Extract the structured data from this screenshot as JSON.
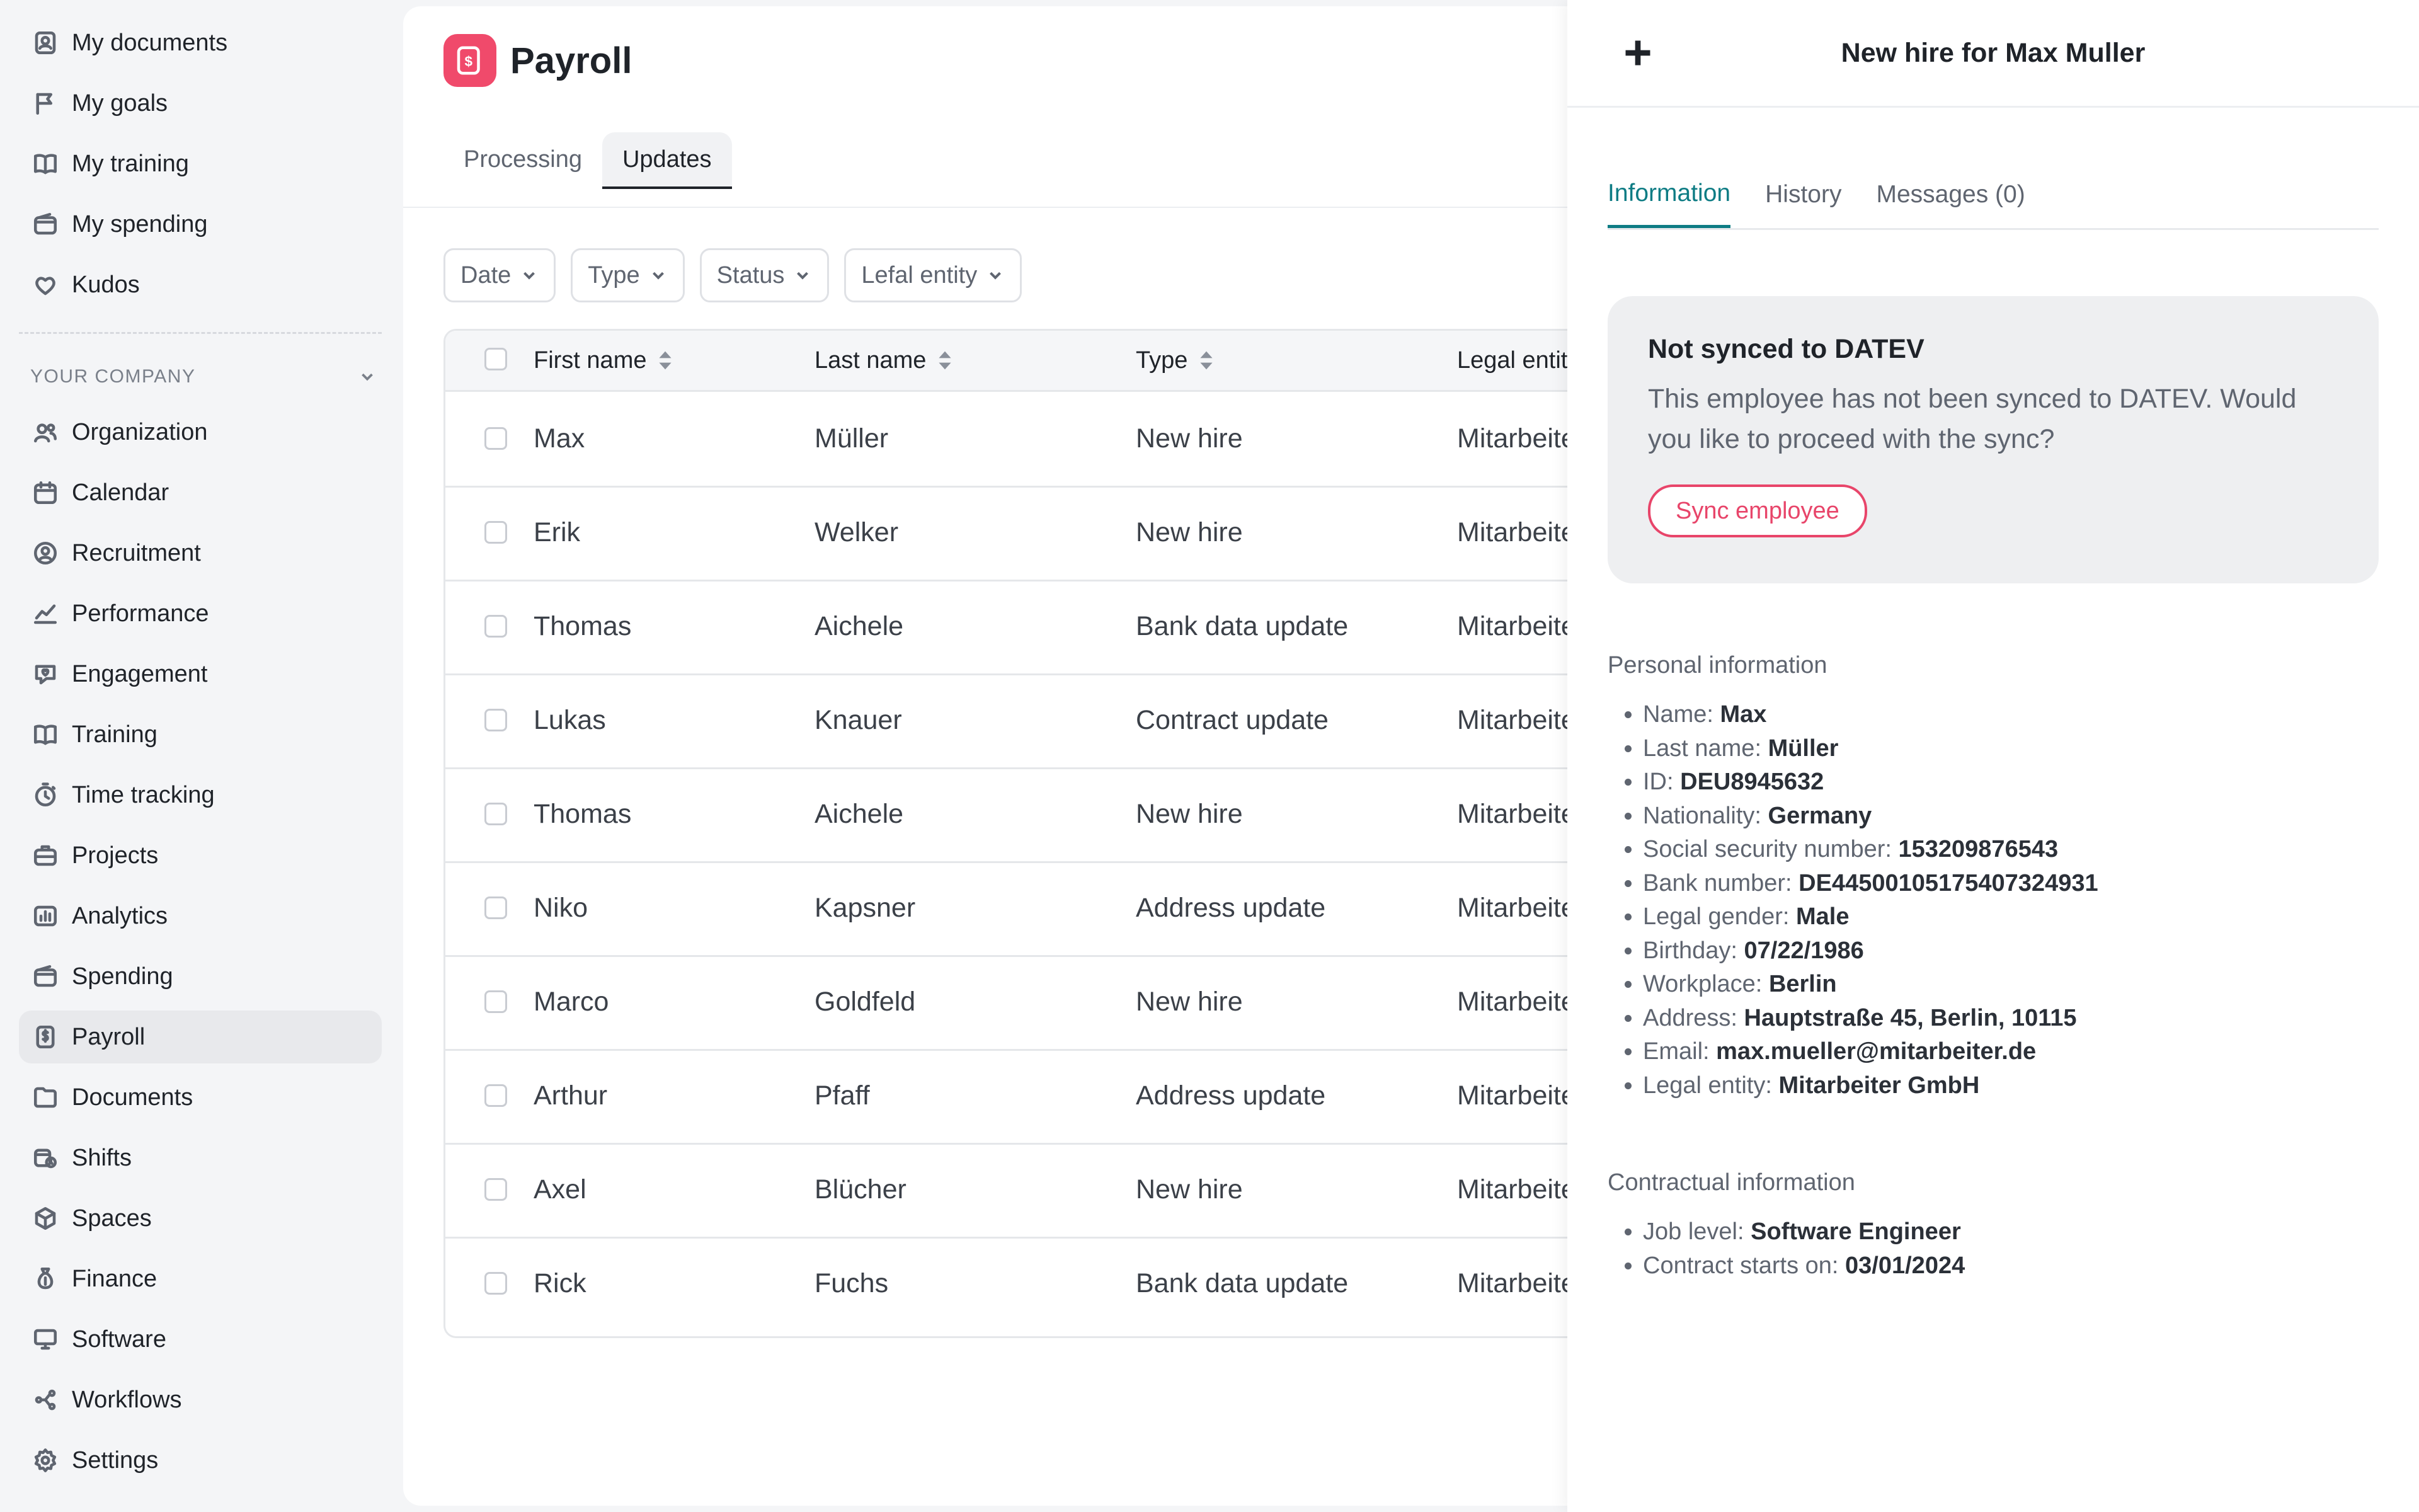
{
  "sidebar": {
    "personal": [
      {
        "label": "My documents",
        "icon": "user-badge-icon"
      },
      {
        "label": "My goals",
        "icon": "flag-icon"
      },
      {
        "label": "My training",
        "icon": "book-icon"
      },
      {
        "label": "My spending",
        "icon": "wallet-icon"
      },
      {
        "label": "Kudos",
        "icon": "heart-icon"
      }
    ],
    "section_label": "YOUR COMPANY",
    "company": [
      {
        "label": "Organization",
        "icon": "users-icon"
      },
      {
        "label": "Calendar",
        "icon": "calendar-icon"
      },
      {
        "label": "Recruitment",
        "icon": "user-search-icon"
      },
      {
        "label": "Performance",
        "icon": "chart-line-icon"
      },
      {
        "label": "Engagement",
        "icon": "chat-heart-icon"
      },
      {
        "label": "Training",
        "icon": "book-icon"
      },
      {
        "label": "Time tracking",
        "icon": "stopwatch-icon"
      },
      {
        "label": "Projects",
        "icon": "briefcase-icon"
      },
      {
        "label": "Analytics",
        "icon": "analytics-icon"
      },
      {
        "label": "Spending",
        "icon": "wallet-icon"
      },
      {
        "label": "Payroll",
        "icon": "dollar-document-icon"
      },
      {
        "label": "Documents",
        "icon": "folder-icon"
      },
      {
        "label": "Shifts",
        "icon": "calendar-clock-icon"
      },
      {
        "label": "Spaces",
        "icon": "cube-icon"
      },
      {
        "label": "Finance",
        "icon": "money-bag-icon"
      },
      {
        "label": "Software",
        "icon": "monitor-icon"
      },
      {
        "label": "Workflows",
        "icon": "workflow-icon"
      },
      {
        "label": "Settings",
        "icon": "gear-icon"
      }
    ],
    "active": "Payroll"
  },
  "main": {
    "title": "Payroll",
    "tabs": [
      {
        "label": "Processing",
        "active": false
      },
      {
        "label": "Updates",
        "active": true
      }
    ],
    "filters": [
      "Date",
      "Type",
      "Status",
      "Lefal entity"
    ],
    "table": {
      "columns": [
        "First name",
        "Last name",
        "Type",
        "Legal entit"
      ],
      "rows": [
        {
          "first": "Max",
          "last": "Müller",
          "type": "New hire",
          "entity": "Mitarbeite"
        },
        {
          "first": "Erik",
          "last": "Welker",
          "type": "New hire",
          "entity": "Mitarbeite"
        },
        {
          "first": "Thomas",
          "last": "Aichele",
          "type": "Bank data update",
          "entity": "Mitarbeite"
        },
        {
          "first": "Lukas",
          "last": "Knauer",
          "type": "Contract update",
          "entity": "Mitarbeite"
        },
        {
          "first": "Thomas",
          "last": "Aichele",
          "type": "New hire",
          "entity": "Mitarbeite"
        },
        {
          "first": "Niko",
          "last": "Kapsner",
          "type": "Address update",
          "entity": "Mitarbeite"
        },
        {
          "first": "Marco",
          "last": "Goldfeld",
          "type": "New hire",
          "entity": "Mitarbeite"
        },
        {
          "first": "Arthur",
          "last": "Pfaff",
          "type": "Address update",
          "entity": "Mitarbeite"
        },
        {
          "first": "Axel",
          "last": "Blücher",
          "type": "New hire",
          "entity": "Mitarbeite"
        },
        {
          "first": "Rick",
          "last": "Fuchs",
          "type": "Bank data update",
          "entity": "Mitarbeite"
        }
      ]
    }
  },
  "panel": {
    "title": "New hire for Max Muller",
    "tabs": [
      {
        "label": "Information",
        "active": true
      },
      {
        "label": "History",
        "active": false
      },
      {
        "label": "Messages (0)",
        "active": false
      }
    ],
    "sync": {
      "title": "Not synced to DATEV",
      "text": "This employee has not been synced to DATEV. Would you like to proceed with the sync?",
      "button": "Sync employee"
    },
    "personal_heading": "Personal information",
    "personal": [
      {
        "label": "Name:",
        "value": "Max"
      },
      {
        "label": "Last name:",
        "value": "Müller"
      },
      {
        "label": "ID:",
        "value": "DEU8945632"
      },
      {
        "label": "Nationality:",
        "value": "Germany"
      },
      {
        "label": "Social security number:",
        "value": "153209876543"
      },
      {
        "label": "Bank number:",
        "value": "DE44500105175407324931"
      },
      {
        "label": "Legal gender:",
        "value": "Male"
      },
      {
        "label": "Birthday:",
        "value": "07/22/1986"
      },
      {
        "label": "Workplace:",
        "value": "Berlin"
      },
      {
        "label": "Address:",
        "value": "Hauptstraße 45, Berlin, 10115"
      },
      {
        "label": "Email:",
        "value": "max.mueller@mitarbeiter.de"
      },
      {
        "label": "Legal entity:",
        "value": "Mitarbeiter GmbH"
      }
    ],
    "contract_heading": "Contractual information",
    "contract": [
      {
        "label": "Job level:",
        "value": "Software Engineer"
      },
      {
        "label": "Contract starts on:",
        "value": "03/01/2024"
      }
    ]
  },
  "colors": {
    "accent_teal": "#0e7c84",
    "brand_pink": "#f04a6b",
    "sync_red": "#e8456a"
  }
}
